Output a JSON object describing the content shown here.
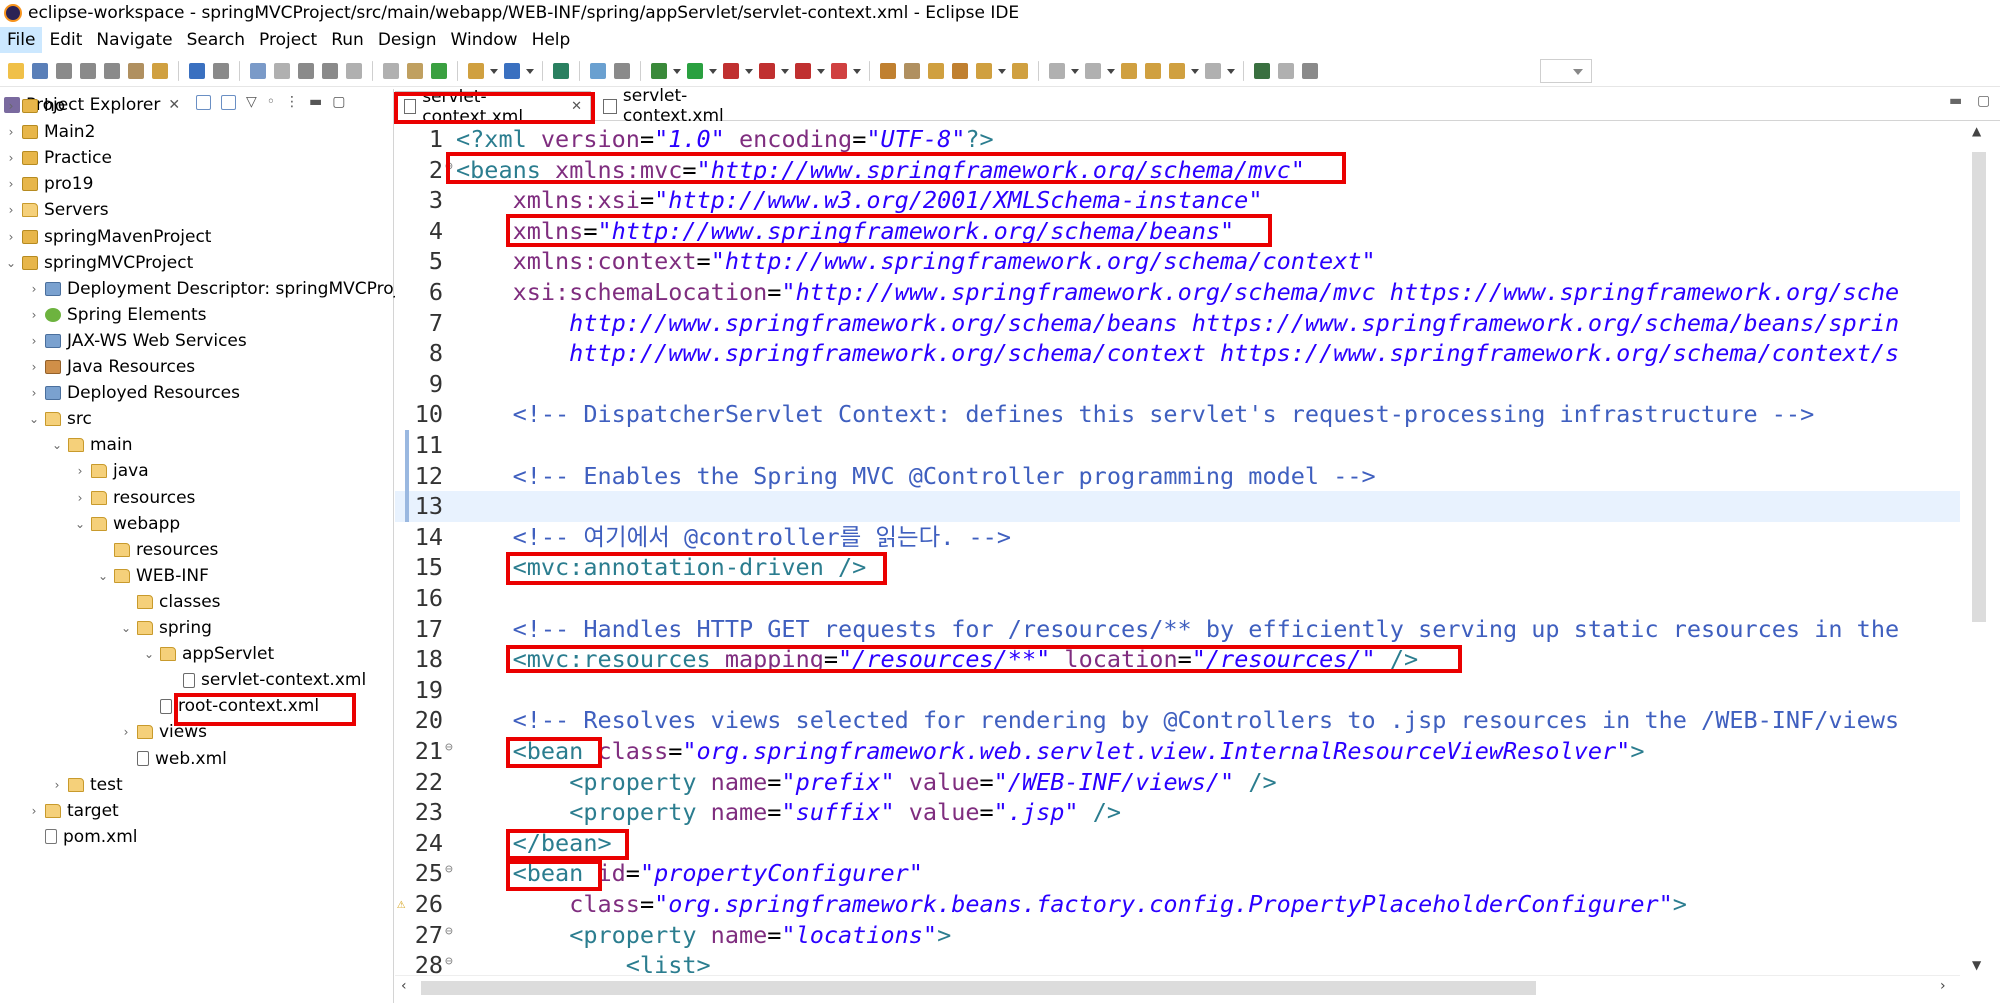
{
  "window": {
    "title": "eclipse-workspace - springMVCProject/src/main/webapp/WEB-INF/spring/appServlet/servlet-context.xml - Eclipse IDE"
  },
  "menu": [
    "File",
    "Edit",
    "Navigate",
    "Search",
    "Project",
    "Run",
    "Design",
    "Window",
    "Help"
  ],
  "explorer": {
    "title": "Project Explorer",
    "tree": [
      {
        "label": "ho",
        "icon": "project-icon",
        "chevron": "›"
      },
      {
        "label": "Main2",
        "icon": "project-icon",
        "chevron": "›"
      },
      {
        "label": "Practice",
        "icon": "project-icon",
        "chevron": "›"
      },
      {
        "label": "pro19",
        "icon": "project-icon",
        "chevron": "›"
      },
      {
        "label": "Servers",
        "icon": "folder-icon",
        "chevron": "›"
      },
      {
        "label": "springMavenProject",
        "icon": "project-icon",
        "chevron": "›"
      },
      {
        "label": "springMVCProject",
        "icon": "project-icon",
        "chevron": "⌄"
      },
      {
        "label": "Deployment Descriptor: springMVCProjec",
        "icon": "web-descriptor-icon",
        "chevron": "›"
      },
      {
        "label": "Spring Elements",
        "icon": "spring-icon",
        "chevron": "›"
      },
      {
        "label": "JAX-WS Web Services",
        "icon": "web-services-icon",
        "chevron": "›"
      },
      {
        "label": "Java Resources",
        "icon": "jar-icon",
        "chevron": "›"
      },
      {
        "label": "Deployed Resources",
        "icon": "web-descriptor-icon",
        "chevron": "›"
      },
      {
        "label": "src",
        "icon": "folder-icon",
        "chevron": "⌄"
      },
      {
        "label": "main",
        "icon": "folder-icon",
        "chevron": "⌄"
      },
      {
        "label": "java",
        "icon": "folder-icon",
        "chevron": "›"
      },
      {
        "label": "resources",
        "icon": "folder-icon",
        "chevron": "›"
      },
      {
        "label": "webapp",
        "icon": "folder-icon",
        "chevron": "⌄"
      },
      {
        "label": "resources",
        "icon": "folder-icon",
        "chevron": ""
      },
      {
        "label": "WEB-INF",
        "icon": "folder-icon",
        "chevron": "⌄"
      },
      {
        "label": "classes",
        "icon": "folder-icon",
        "chevron": ""
      },
      {
        "label": "spring",
        "icon": "folder-icon",
        "chevron": "⌄"
      },
      {
        "label": "appServlet",
        "icon": "folder-icon",
        "chevron": "⌄"
      },
      {
        "label": "servlet-context.xml",
        "icon": "xml-file-icon",
        "chevron": ""
      },
      {
        "label": "root-context.xml",
        "icon": "xml-file-icon",
        "chevron": ""
      },
      {
        "label": "views",
        "icon": "folder-icon",
        "chevron": "›"
      },
      {
        "label": "web.xml",
        "icon": "xml-file-icon",
        "chevron": ""
      },
      {
        "label": "test",
        "icon": "folder-icon",
        "chevron": "›"
      },
      {
        "label": "target",
        "icon": "folder-icon",
        "chevron": "›"
      },
      {
        "label": "pom.xml",
        "icon": "file-icon",
        "chevron": ""
      }
    ]
  },
  "editor": {
    "tabs": [
      {
        "label": "servlet-context.xml",
        "active": true,
        "close": "✕"
      },
      {
        "label": "servlet-context.xml",
        "active": false,
        "close": ""
      }
    ],
    "lines": [
      [
        [
          "pi",
          "<?xml "
        ],
        [
          "attr",
          "version"
        ],
        [
          "plain",
          "="
        ],
        [
          "val",
          "\"1.0\""
        ],
        [
          "plain",
          " "
        ],
        [
          "attr",
          "encoding"
        ],
        [
          "plain",
          "="
        ],
        [
          "val",
          "\"UTF-8\""
        ],
        [
          "pi",
          "?>"
        ]
      ],
      [
        [
          "tag",
          "<beans "
        ],
        [
          "attr",
          "xmlns:mvc"
        ],
        [
          "plain",
          "="
        ],
        [
          "val",
          "\"http://www.springframework.org/schema/mvc\""
        ]
      ],
      [
        [
          "plain",
          "    "
        ],
        [
          "attr",
          "xmlns:xsi"
        ],
        [
          "plain",
          "="
        ],
        [
          "val",
          "\"http://www.w3.org/2001/XMLSchema-instance\""
        ]
      ],
      [
        [
          "plain",
          "    "
        ],
        [
          "attr",
          "xmlns"
        ],
        [
          "plain",
          "="
        ],
        [
          "val",
          "\"http://www.springframework.org/schema/beans\""
        ]
      ],
      [
        [
          "plain",
          "    "
        ],
        [
          "attr",
          "xmlns:context"
        ],
        [
          "plain",
          "="
        ],
        [
          "val",
          "\"http://www.springframework.org/schema/context\""
        ]
      ],
      [
        [
          "plain",
          "    "
        ],
        [
          "attr",
          "xsi:schemaLocation"
        ],
        [
          "plain",
          "="
        ],
        [
          "val",
          "\"http://www.springframework.org/schema/mvc https://www.springframework.org/sche"
        ]
      ],
      [
        [
          "val",
          "        http://www.springframework.org/schema/beans https://www.springframework.org/schema/beans/sprin"
        ]
      ],
      [
        [
          "val",
          "        http://www.springframework.org/schema/context https://www.springframework.org/schema/context/s"
        ]
      ],
      [
        [
          "plain",
          ""
        ]
      ],
      [
        [
          "plain",
          "    "
        ],
        [
          "cmt",
          "<!-- DispatcherServlet Context: defines this servlet's request-processing infrastructure -->"
        ]
      ],
      [
        [
          "plain",
          ""
        ]
      ],
      [
        [
          "plain",
          "    "
        ],
        [
          "cmt",
          "<!-- Enables the Spring MVC @Controller programming model -->"
        ]
      ],
      [
        [
          "plain",
          ""
        ]
      ],
      [
        [
          "plain",
          "    "
        ],
        [
          "cmt",
          "<!-- 여기에서 @controller를 읽는다. -->"
        ]
      ],
      [
        [
          "plain",
          "    "
        ],
        [
          "tag",
          "<mvc:annotation-driven />"
        ]
      ],
      [
        [
          "plain",
          ""
        ]
      ],
      [
        [
          "plain",
          "    "
        ],
        [
          "cmt",
          "<!-- Handles HTTP GET requests for /resources/** by efficiently serving up static resources in the"
        ]
      ],
      [
        [
          "plain",
          "    "
        ],
        [
          "tag",
          "<mvc:resources "
        ],
        [
          "attr",
          "mapping"
        ],
        [
          "plain",
          "="
        ],
        [
          "val",
          "\"/resources/**\""
        ],
        [
          "plain",
          " "
        ],
        [
          "attr",
          "location"
        ],
        [
          "plain",
          "="
        ],
        [
          "val",
          "\"/resources/\""
        ],
        [
          "tag",
          " />"
        ]
      ],
      [
        [
          "plain",
          ""
        ]
      ],
      [
        [
          "plain",
          "    "
        ],
        [
          "cmt",
          "<!-- Resolves views selected for rendering by @Controllers to .jsp resources in the /WEB-INF/views"
        ]
      ],
      [
        [
          "plain",
          "    "
        ],
        [
          "tag",
          "<bean "
        ],
        [
          "attr",
          "class"
        ],
        [
          "plain",
          "="
        ],
        [
          "val",
          "\"org.springframework.web.servlet.view.InternalResourceViewResolver\""
        ],
        [
          "tag",
          ">"
        ]
      ],
      [
        [
          "plain",
          "        "
        ],
        [
          "tag",
          "<property "
        ],
        [
          "attr",
          "name"
        ],
        [
          "plain",
          "="
        ],
        [
          "val",
          "\"prefix\""
        ],
        [
          "plain",
          " "
        ],
        [
          "attr",
          "value"
        ],
        [
          "plain",
          "="
        ],
        [
          "val",
          "\"/WEB-INF/views/\""
        ],
        [
          "tag",
          " />"
        ]
      ],
      [
        [
          "plain",
          "        "
        ],
        [
          "tag",
          "<property "
        ],
        [
          "attr",
          "name"
        ],
        [
          "plain",
          "="
        ],
        [
          "val",
          "\"suffix\""
        ],
        [
          "plain",
          " "
        ],
        [
          "attr",
          "value"
        ],
        [
          "plain",
          "="
        ],
        [
          "val",
          "\".jsp\""
        ],
        [
          "tag",
          " />"
        ]
      ],
      [
        [
          "plain",
          "    "
        ],
        [
          "tag",
          "</bean>"
        ]
      ],
      [
        [
          "plain",
          "    "
        ],
        [
          "tag",
          "<bean "
        ],
        [
          "attr",
          "id"
        ],
        [
          "plain",
          "="
        ],
        [
          "val",
          "\"propertyConfigurer\""
        ]
      ],
      [
        [
          "plain",
          "        "
        ],
        [
          "attr",
          "class"
        ],
        [
          "plain",
          "="
        ],
        [
          "val",
          "\"org.springframework.beans.factory.config.PropertyPlaceholderConfigurer\""
        ],
        [
          "tag",
          ">"
        ]
      ],
      [
        [
          "plain",
          "        "
        ],
        [
          "tag",
          "<property "
        ],
        [
          "attr",
          "name"
        ],
        [
          "plain",
          "="
        ],
        [
          "val",
          "\"locations\""
        ],
        [
          "tag",
          ">"
        ]
      ],
      [
        [
          "plain",
          "            "
        ],
        [
          "tag",
          "<list>"
        ]
      ]
    ]
  },
  "colors": {
    "highlight": "#ea0000",
    "tag": "#2b7d8f",
    "attr": "#7f2d7f",
    "value": "#2a00ff",
    "comment": "#3f5fbf",
    "current_line": "#e8f2fe"
  }
}
